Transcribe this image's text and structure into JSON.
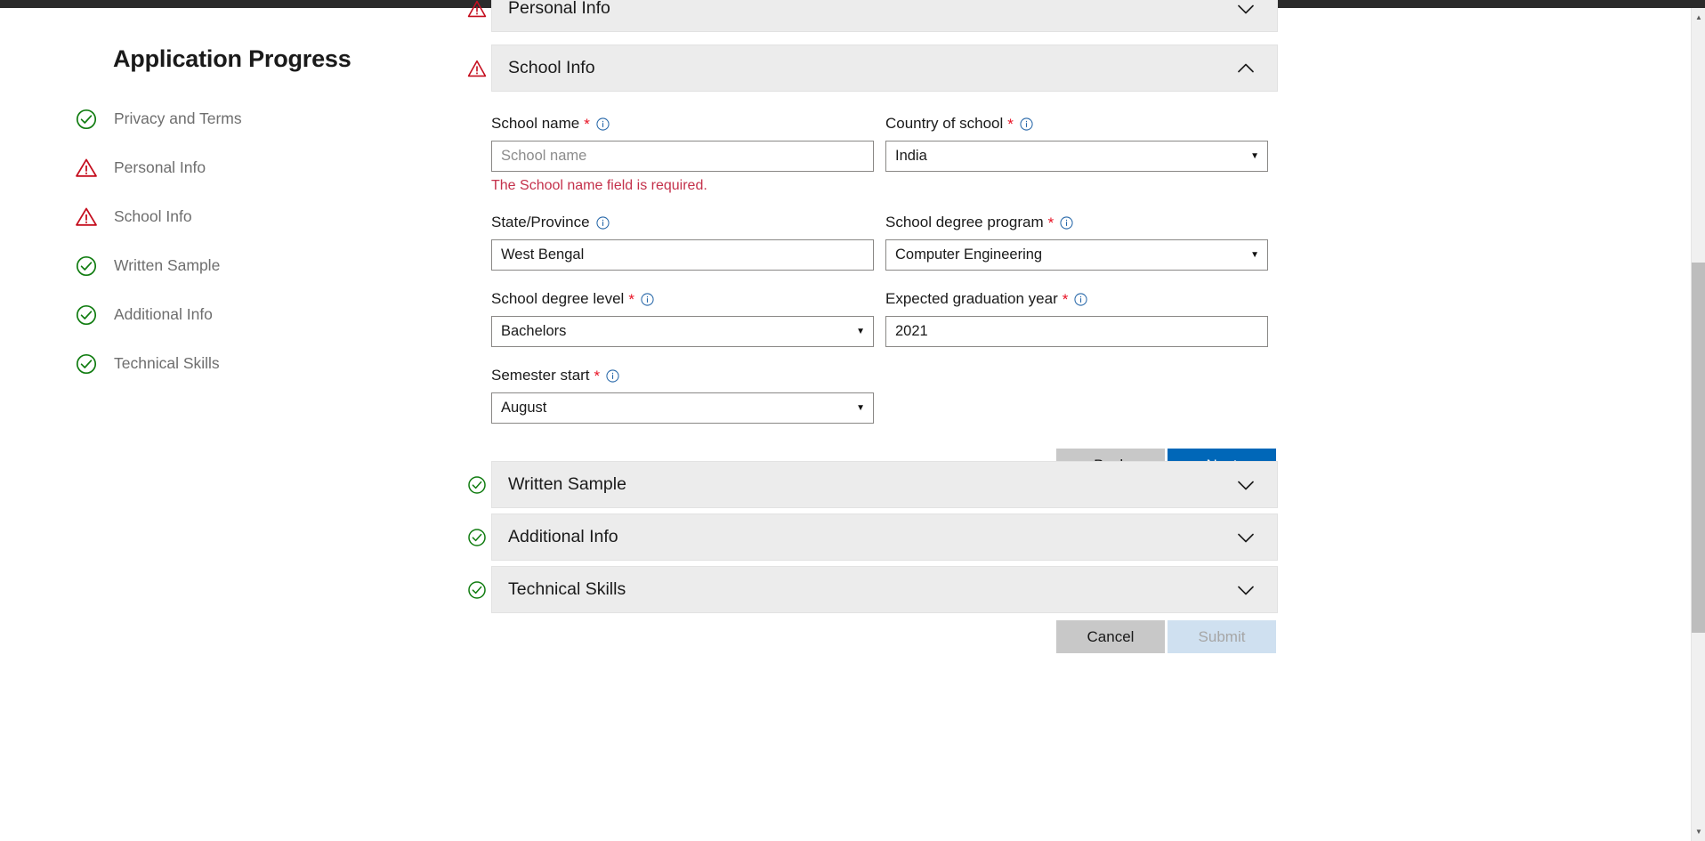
{
  "sidebar": {
    "title": "Application Progress",
    "items": [
      {
        "label": "Privacy and Terms",
        "status": "complete"
      },
      {
        "label": "Personal Info",
        "status": "warning"
      },
      {
        "label": "School Info",
        "status": "warning"
      },
      {
        "label": "Written Sample",
        "status": "complete"
      },
      {
        "label": "Additional Info",
        "status": "complete"
      },
      {
        "label": "Technical Skills",
        "status": "complete"
      }
    ]
  },
  "sections": [
    {
      "title": "Personal Info",
      "status": "warning",
      "expanded": false,
      "chevron": "chevron-down-icon"
    },
    {
      "title": "School Info",
      "status": "warning",
      "expanded": true,
      "chevron": "chevron-up-icon"
    },
    {
      "title": "Written Sample",
      "status": "complete",
      "expanded": false,
      "chevron": "chevron-down-icon"
    },
    {
      "title": "Additional Info",
      "status": "complete",
      "expanded": false,
      "chevron": "chevron-down-icon"
    },
    {
      "title": "Technical Skills",
      "status": "complete",
      "expanded": false,
      "chevron": "chevron-down-icon"
    }
  ],
  "school_form": {
    "school_name": {
      "label": "School name",
      "required": true,
      "value": "",
      "placeholder": "School name",
      "error": "The School name field is required.",
      "type": "text"
    },
    "country_of_school": {
      "label": "Country of school",
      "required": true,
      "value": "India",
      "type": "select"
    },
    "state_province": {
      "label": "State/Province",
      "required": false,
      "value": "West Bengal",
      "type": "text"
    },
    "school_degree_program": {
      "label": "School degree program",
      "required": true,
      "value": "Computer Engineering",
      "type": "select"
    },
    "school_degree_level": {
      "label": "School degree level",
      "required": true,
      "value": "Bachelors",
      "type": "select"
    },
    "expected_graduation_year": {
      "label": "Expected graduation year",
      "required": true,
      "value": "2021",
      "type": "text"
    },
    "semester_start": {
      "label": "Semester start",
      "required": true,
      "value": "August",
      "type": "select"
    }
  },
  "buttons": {
    "back": "Back",
    "next": "Next",
    "cancel": "Cancel",
    "submit": "Submit"
  },
  "colors": {
    "primary": "#0067b8",
    "secondary": "#c8c8c8",
    "submit_disabled_bg": "#cfe0f0",
    "error_text": "#c4314b",
    "required_star": "#e81123",
    "warning": "#c50f1f",
    "success": "#107c10",
    "section_header_bg": "#ececec",
    "info_icon": "#2566a8"
  },
  "icons": {
    "complete": "check-circle-icon",
    "warning": "warning-triangle-icon",
    "info": "info-circle-icon",
    "caret": "▼"
  },
  "scrollbar": {
    "up_arrow": "▲",
    "down_arrow": "▼"
  }
}
